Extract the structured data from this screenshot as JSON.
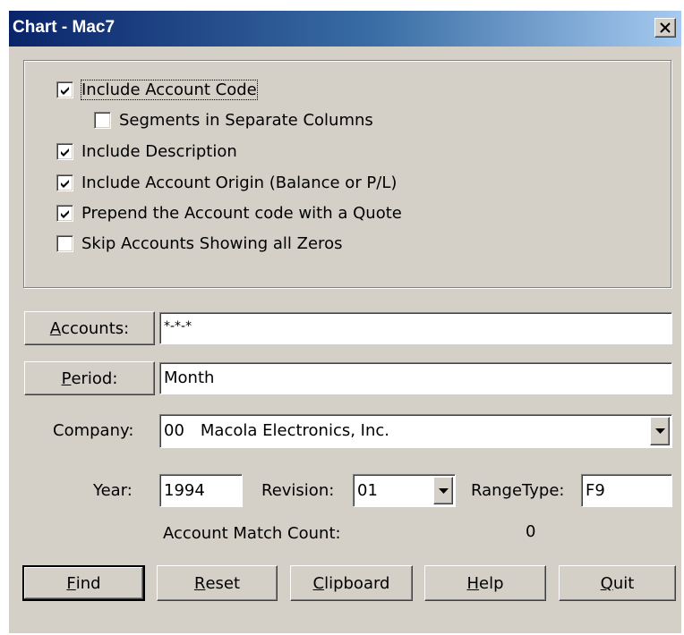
{
  "window": {
    "title": "Chart - Mac7"
  },
  "options": {
    "include_account_code": {
      "label": "Include Account Code",
      "checked": true
    },
    "segments_separate": {
      "label": "Segments in Separate Columns",
      "checked": false
    },
    "include_description": {
      "label": "Include Description",
      "checked": true
    },
    "include_origin": {
      "label": "Include Account Origin (Balance or P/L)",
      "checked": true
    },
    "prepend_quote": {
      "label": "Prepend the Account code with a Quote",
      "checked": true
    },
    "skip_zeros": {
      "label": "Skip Accounts Showing all Zeros",
      "checked": false
    }
  },
  "accounts": {
    "button_first": "A",
    "button_rest": "ccounts:",
    "value": "*-*-*"
  },
  "period": {
    "button_first": "P",
    "button_rest": "eriod:",
    "value": "Month"
  },
  "company": {
    "label": "Company:",
    "code": "00",
    "name": "Macola Electronics, Inc."
  },
  "year": {
    "label": "Year:",
    "value": "1994"
  },
  "revision": {
    "label": "Revision:",
    "value": "01"
  },
  "range_type": {
    "label": "RangeType:",
    "value": "F9"
  },
  "match_count": {
    "label": "Account Match Count:",
    "value": "0"
  },
  "buttons": {
    "find": {
      "first": "F",
      "rest": "ind"
    },
    "reset": {
      "first": "R",
      "rest": "eset"
    },
    "clipboard": {
      "first": "C",
      "rest": "lipboard"
    },
    "help": {
      "first": "H",
      "rest": "elp"
    },
    "quit": {
      "first": "Q",
      "rest": "uit"
    }
  }
}
